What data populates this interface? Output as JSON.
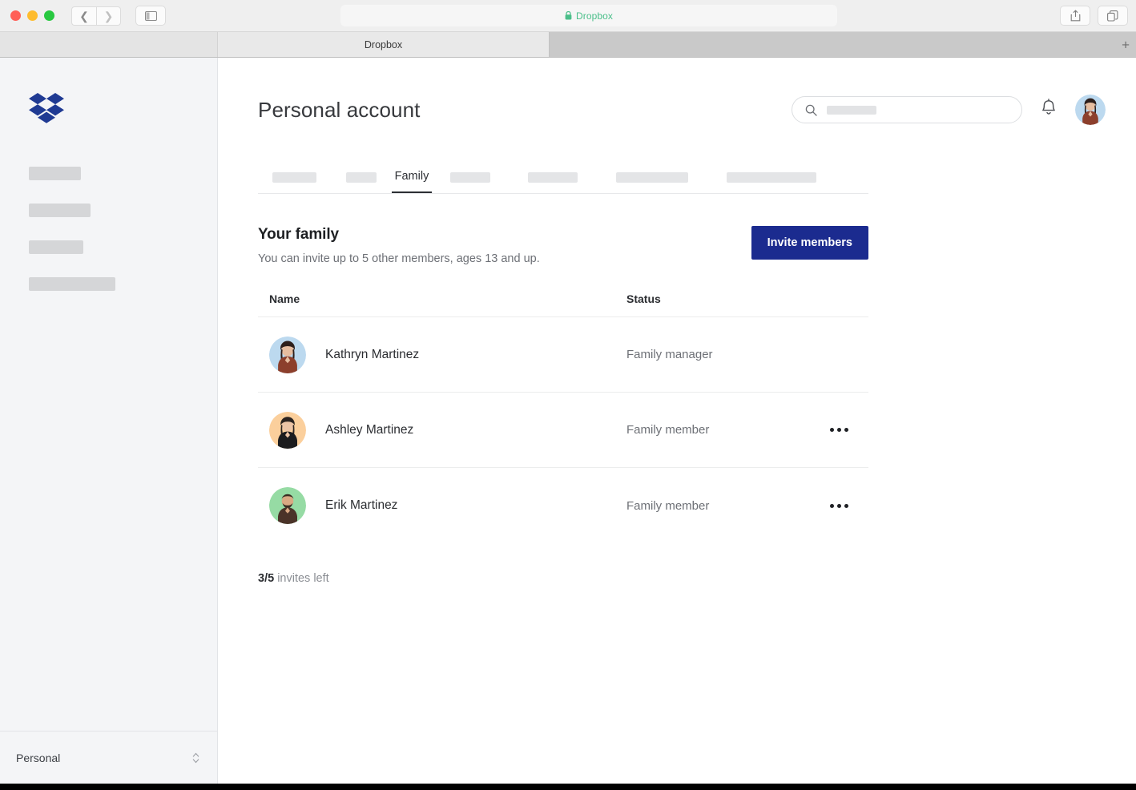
{
  "browser": {
    "traffic_lights": [
      "close",
      "minimize",
      "maximize"
    ],
    "back_icon": "chevron-left-icon",
    "forward_icon": "chevron-right-icon",
    "sidebar_toggle_icon": "sidebar-toggle-icon",
    "address": {
      "lock_icon": "lock-icon",
      "text": "Dropbox",
      "text_color": "#4bbf8a"
    },
    "share_icon": "share-icon",
    "tabs_overview_icon": "tab-overview-icon",
    "tab": {
      "title": "Dropbox"
    },
    "new_tab_label": "+"
  },
  "sidebar": {
    "logo_icon": "dropbox-logo-icon",
    "logo_color": "#1f3a93",
    "nav_placeholders": 4,
    "footer": {
      "account_label": "Personal",
      "stepper_icon": "chevron-up-down-icon"
    }
  },
  "header": {
    "title": "Personal account",
    "search": {
      "icon": "search-icon",
      "value": "",
      "placeholder": ""
    },
    "notifications_icon": "bell-icon",
    "avatar_icon": "user-avatar",
    "avatar_bg": "#bcd9ef"
  },
  "tabs": [
    {
      "label": "",
      "placeholder_width": 55,
      "active": false
    },
    {
      "label": "",
      "placeholder_width": 38,
      "active": false
    },
    {
      "label": "Family",
      "placeholder_width": 0,
      "active": true
    },
    {
      "label": "",
      "placeholder_width": 50,
      "active": false
    },
    {
      "label": "",
      "placeholder_width": 62,
      "active": false
    },
    {
      "label": "",
      "placeholder_width": 90,
      "active": false
    },
    {
      "label": "",
      "placeholder_width": 112,
      "active": false
    }
  ],
  "family": {
    "title": "Your family",
    "subtitle": "You can invite up to 5 other members, ages 13 and up.",
    "invite_button": "Invite members",
    "invite_button_color": "#1b2b8f",
    "columns": {
      "name": "Name",
      "status": "Status"
    },
    "members": [
      {
        "name": "Kathryn Martinez",
        "status": "Family manager",
        "avatar_bg": "#bcd9ef",
        "hair": "#2d1f1c",
        "shirt": "#8c3f2c",
        "skin": "#e6bda0",
        "has_menu": false,
        "menu_icon": ""
      },
      {
        "name": "Ashley Martinez",
        "status": "Family member",
        "avatar_bg": "#fbcf9c",
        "hair": "#2b2320",
        "shirt": "#1c1c1e",
        "skin": "#ecc4a6",
        "has_menu": true,
        "menu_icon": "more-horizontal-icon"
      },
      {
        "name": "Erik Martinez",
        "status": "Family member",
        "avatar_bg": "#96dba4",
        "hair": "#3a2c22",
        "shirt": "#4a3328",
        "skin": "#d9a983",
        "has_menu": true,
        "menu_icon": "more-horizontal-icon"
      }
    ],
    "invites_left_count": "3/5",
    "invites_left_label": "invites left"
  }
}
